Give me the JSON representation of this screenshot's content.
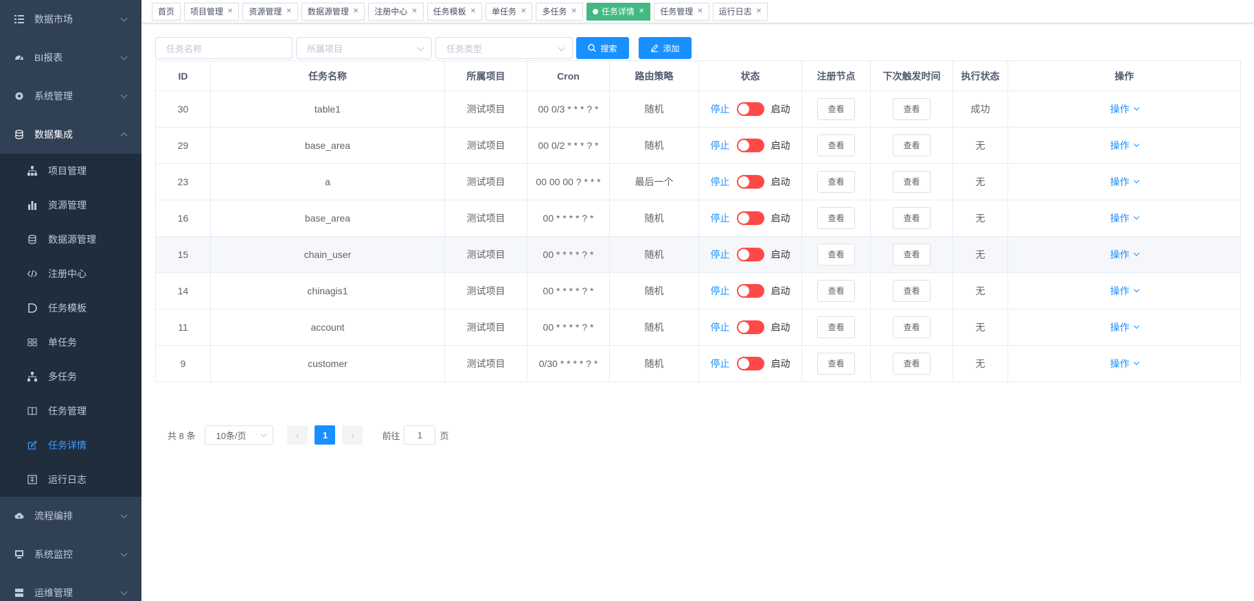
{
  "sidebar": {
    "menus": [
      {
        "label": "数据市场",
        "icon": "list-icon"
      },
      {
        "label": "BI报表",
        "icon": "dashboard-icon"
      },
      {
        "label": "系统管理",
        "icon": "gear-icon"
      },
      {
        "label": "数据集成",
        "icon": "database-icon"
      }
    ],
    "sub_items": [
      {
        "label": "项目管理",
        "icon": "tree-icon"
      },
      {
        "label": "资源管理",
        "icon": "bar-chart-icon"
      },
      {
        "label": "数据源管理",
        "icon": "database-icon"
      },
      {
        "label": "注册中心",
        "icon": "code-icon"
      },
      {
        "label": "任务模板",
        "icon": "letter-d-icon"
      },
      {
        "label": "单任务",
        "icon": "tasks-icon"
      },
      {
        "label": "多任务",
        "icon": "tree-icon"
      },
      {
        "label": "任务管理",
        "icon": "book-icon"
      },
      {
        "label": "任务详情",
        "icon": "edit-icon"
      },
      {
        "label": "运行日志",
        "icon": "log-icon"
      }
    ],
    "bottom_menus": [
      {
        "label": "流程编排",
        "icon": "cloud-icon"
      },
      {
        "label": "系统监控",
        "icon": "monitor-icon"
      },
      {
        "label": "运维管理",
        "icon": "server-icon"
      }
    ]
  },
  "tags": [
    {
      "label": "首页",
      "closable": false,
      "active": false
    },
    {
      "label": "项目管理",
      "closable": true,
      "active": false
    },
    {
      "label": "资源管理",
      "closable": true,
      "active": false
    },
    {
      "label": "数据源管理",
      "closable": true,
      "active": false
    },
    {
      "label": "注册中心",
      "closable": true,
      "active": false
    },
    {
      "label": "任务模板",
      "closable": true,
      "active": false
    },
    {
      "label": "单任务",
      "closable": true,
      "active": false
    },
    {
      "label": "多任务",
      "closable": true,
      "active": false
    },
    {
      "label": "任务详情",
      "closable": true,
      "active": true
    },
    {
      "label": "任务管理",
      "closable": true,
      "active": false
    },
    {
      "label": "运行日志",
      "closable": true,
      "active": false
    }
  ],
  "filters": {
    "task_name_placeholder": "任务名称",
    "project_placeholder": "所属项目",
    "task_type_placeholder": "任务类型",
    "search_label": "搜索",
    "add_label": "添加"
  },
  "table": {
    "headers": [
      "ID",
      "任务名称",
      "所属项目",
      "Cron",
      "路由策略",
      "状态",
      "注册节点",
      "下次触发时间",
      "执行状态",
      "操作"
    ],
    "stop_label": "停止",
    "start_label": "启动",
    "view_label": "查看",
    "op_label": "操作",
    "rows": [
      {
        "id": "30",
        "name": "table1",
        "project": "测试项目",
        "cron": "00 0/3 * * * ? *",
        "route": "随机",
        "exec": "成功"
      },
      {
        "id": "29",
        "name": "base_area",
        "project": "测试项目",
        "cron": "00 0/2 * * * ? *",
        "route": "随机",
        "exec": "无"
      },
      {
        "id": "23",
        "name": "a",
        "project": "测试项目",
        "cron": "00 00 00 ? * * *",
        "route": "最后一个",
        "exec": "无"
      },
      {
        "id": "16",
        "name": "base_area",
        "project": "测试项目",
        "cron": "00 * * * * ? *",
        "route": "随机",
        "exec": "无"
      },
      {
        "id": "15",
        "name": "chain_user",
        "project": "测试项目",
        "cron": "00 * * * * ? *",
        "route": "随机",
        "exec": "无"
      },
      {
        "id": "14",
        "name": "chinagis1",
        "project": "测试项目",
        "cron": "00 * * * * ? *",
        "route": "随机",
        "exec": "无"
      },
      {
        "id": "11",
        "name": "account",
        "project": "测试项目",
        "cron": "00 * * * * ? *",
        "route": "随机",
        "exec": "无"
      },
      {
        "id": "9",
        "name": "customer",
        "project": "测试项目",
        "cron": "0/30 * * * * ? *",
        "route": "随机",
        "exec": "无"
      }
    ]
  },
  "pagination": {
    "total": "共 8 条",
    "page_size": "10条/页",
    "current_page": "1",
    "goto_prefix": "前往",
    "goto_value": "1",
    "goto_suffix": "页"
  },
  "colors": {
    "sidebar_bg": "#304156",
    "submenu_bg": "#1f2d3d",
    "active_tag": "#42b983",
    "primary": "#1890ff",
    "switch_off": "#ff4949"
  }
}
